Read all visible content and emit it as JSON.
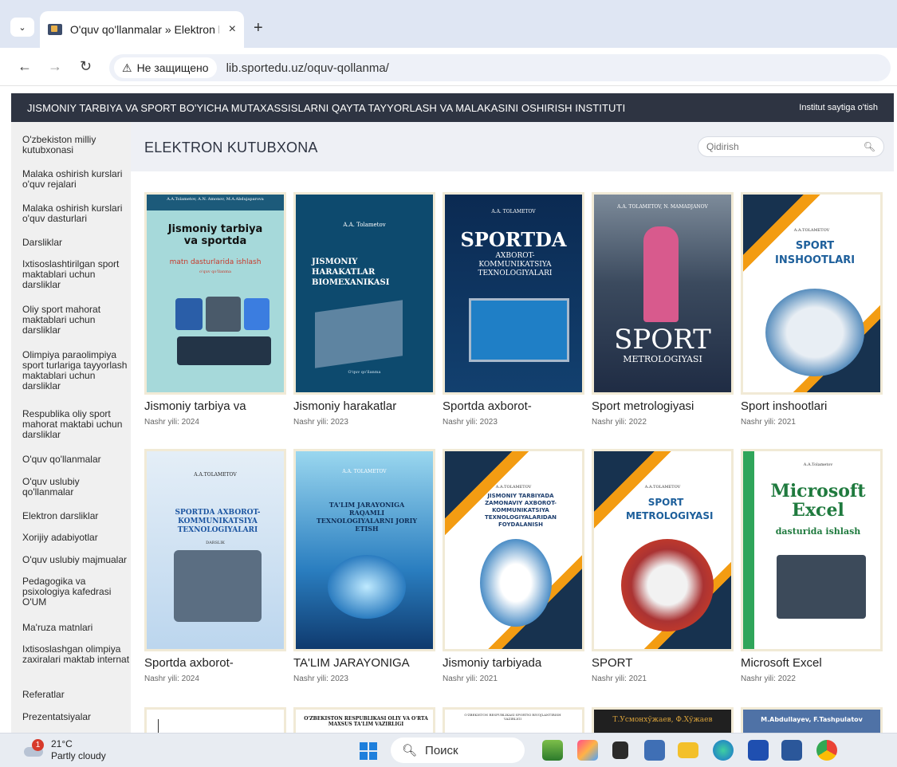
{
  "browser": {
    "tab_title": "O'quv qo'llanmalar » Elektron kutubxona",
    "close_glyph": "×",
    "newtab_glyph": "+",
    "security_label": "Не защищено",
    "url": "lib.sportedu.uz/oquv-qollanma/"
  },
  "site": {
    "institute": "JISMONIY TARBIYA VA SPORT BO'YICHA MUTAXASSISLARNI QAYTA TAYYORLASH VA MALAKASINI OSHIRISH INSTITUTI",
    "site_link": "Institut saytiga o'tish",
    "page_heading": "ELEKTRON KUTUBXONA",
    "search_placeholder": "Qidirish"
  },
  "sidebar": {
    "items": [
      "O'zbekiston milliy kutubxonasi",
      "Malaka oshirish kurslari o'quv rejalari",
      "Malaka oshirish kurslari o'quv dasturlari",
      "Darsliklar",
      "Ixtisoslashtirilgan sport maktablari uchun darsliklar",
      "Oliy sport mahorat maktablari uchun darsliklar",
      "Olimpiya paraolimpiya sport turlariga tayyorlash maktablari uchun darsliklar",
      "Respublika oliy sport mahorat maktabi uchun darsliklar",
      "O'quv qo'llanmalar",
      "O'quv uslubiy qo'llanmalar",
      "Elektron darsliklar",
      "Xorijiy adabiyotlar",
      "O'quv uslubiy majmualar",
      "Pedagogika va psixologiya kafedrasi O'UM",
      "Ma'ruza matnlari",
      "Ixtisoslashgan olimpiya zaxiralari maktab internat",
      "Referatlar",
      "Prezentatsiyalar"
    ]
  },
  "books": [
    {
      "title": "Jismoniy tarbiya va",
      "year": "Nashr yili: 2024",
      "cover_top": "A.A.Tolametov, A.N. Amonov, M.A.Abdujaparova",
      "cover_main": "Jismoniy tarbiya va sportda",
      "cover_sub": "matn dasturlarida ishlash",
      "cover_note": "o'quv qo'llanma"
    },
    {
      "title": "Jismoniy harakatlar",
      "year": "Nashr yili: 2023",
      "cover_top": "A.A. Tolametov",
      "cover_main": "JISMONIY HARAKATLAR BIOMEXANIKASI",
      "cover_note": "O'quv qo'llanma"
    },
    {
      "title": "Sportda axborot-",
      "year": "Nashr yili: 2023",
      "cover_top": "A.A. TOLAMETOV",
      "cover_main": "SPORTDA",
      "cover_sub": "AXBOROT-KOMMUNIKATSIYA TEXNOLOGIYALARI"
    },
    {
      "title": "Sport metrologiyasi",
      "year": "Nashr yili: 2022",
      "cover_top": "A.A. TOLAMETOV, N. MAMADJANOV",
      "cover_main": "SPORT",
      "cover_sub": "METROLOGIYASI"
    },
    {
      "title": "Sport inshootlari",
      "year": "Nashr yili: 2021",
      "cover_top": "A.A.TOLAMETOV",
      "cover_main": "SPORT INSHOOTLARI"
    },
    {
      "title": "Sportda axborot-",
      "year": "Nashr yili: 2024",
      "cover_top": "A.A.TOLAMETOV",
      "cover_main": "SPORTDA AXBOROT-KOMMUNIKATSIYA TEXNOLOGIYALARI",
      "cover_note": "DARSLIK"
    },
    {
      "title": "TA'LIM JARAYONIGA",
      "year": "Nashr yili: 2023",
      "cover_top": "A.A. TOLAMETOV",
      "cover_main": "TA'LIM JARAYONIGA RAQAMLI TEXNOLOGIYALARNI JORIY ETISH"
    },
    {
      "title": "Jismoniy tarbiyada",
      "year": "Nashr yili: 2021",
      "cover_top": "A.A.TOLAMETOV",
      "cover_main": "JISMONIY TARBIYADA ZAMONAVIY AXBOROT-KOMMUNIKATSIYA TEXNOLOGIYALARIDAN FOYDALANISH"
    },
    {
      "title": "SPORT",
      "year": "Nashr yili: 2021",
      "cover_top": "A.A.TOLAMETOV",
      "cover_main": "SPORT METROLOGIYASI"
    },
    {
      "title": "Microsoft Excel",
      "year": "Nashr yili: 2022",
      "cover_top": "A.A.Tolametov",
      "cover_main": "Microsoft Excel",
      "cover_sub": "dasturida ishlash"
    }
  ],
  "partial_covers": [
    {
      "text": ""
    },
    {
      "text": "O'ZBEKISTON RESPUBLIKASI OLIY VA O'RTA MAXSUS TA'LIM VAZIRLIGI"
    },
    {
      "text": "O'ZBEKISTON RESPUBLIKASI SPORTNI RIVOJLANTIRISH VAZIRLIGI"
    },
    {
      "text": "Т.Усмонхўжаев, Ф.Хўжаев"
    },
    {
      "text": "M.Abdullayev, F.Tashpulatov"
    }
  ],
  "taskbar": {
    "weather_badge": "1",
    "temperature": "21°C",
    "condition": "Partly cloudy",
    "search_label": "Поиск"
  }
}
